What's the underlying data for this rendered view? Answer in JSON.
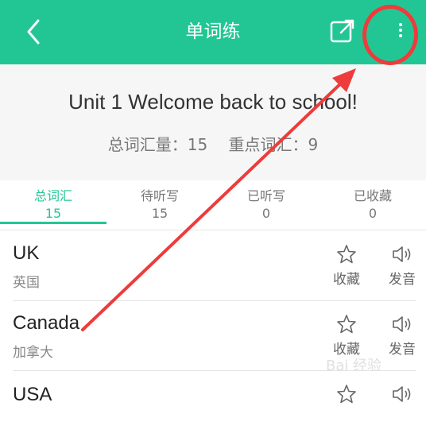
{
  "topbar": {
    "title": "单词练"
  },
  "unit": {
    "title": "Unit 1 Welcome back to school!",
    "total_label": "总词汇量：15",
    "key_label": "重点词汇：9"
  },
  "tabs": [
    {
      "label": "总词汇",
      "count": "15"
    },
    {
      "label": "待听写",
      "count": "15"
    },
    {
      "label": "已听写",
      "count": "0"
    },
    {
      "label": "已收藏",
      "count": "0"
    }
  ],
  "words": [
    {
      "word": "UK",
      "meaning": "英国",
      "fav_label": "收藏",
      "audio_label": "发音"
    },
    {
      "word": "Canada",
      "meaning": "加拿大",
      "fav_label": "收藏",
      "audio_label": "发音"
    },
    {
      "word": "USA",
      "meaning": "",
      "fav_label": "",
      "audio_label": ""
    }
  ],
  "watermark": {
    "text": "Bai 经验"
  },
  "colors": {
    "accent": "#22c694",
    "annotation": "#ee3b3b"
  }
}
